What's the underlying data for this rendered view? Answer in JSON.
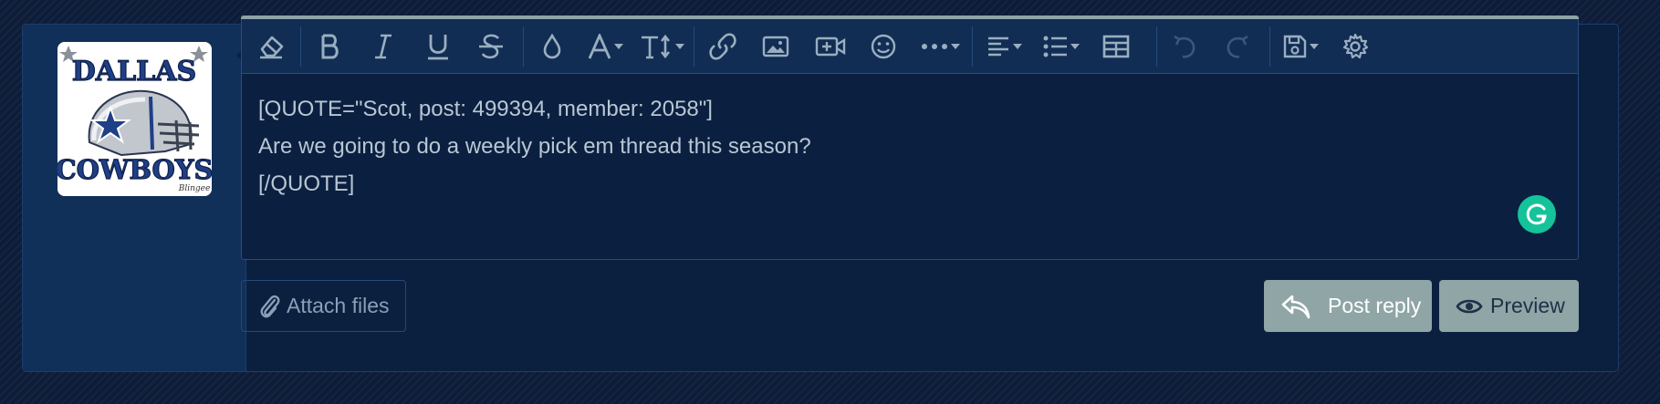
{
  "avatar": {
    "top_text": "DALLAS",
    "bottom_text": "COWBOYS",
    "signature": "Blingee"
  },
  "toolbar": [
    {
      "name": "eraser-icon"
    },
    {
      "name": "bold-icon"
    },
    {
      "name": "italic-icon"
    },
    {
      "name": "underline-icon"
    },
    {
      "name": "strikethrough-icon"
    },
    {
      "name": "text-color-icon"
    },
    {
      "name": "font-family-icon"
    },
    {
      "name": "font-size-icon"
    },
    {
      "name": "link-icon"
    },
    {
      "name": "image-icon"
    },
    {
      "name": "media-icon"
    },
    {
      "name": "emoji-icon"
    },
    {
      "name": "more-icon"
    },
    {
      "name": "align-icon"
    },
    {
      "name": "list-icon"
    },
    {
      "name": "table-icon"
    },
    {
      "name": "undo-icon",
      "disabled": true
    },
    {
      "name": "redo-icon",
      "disabled": true
    },
    {
      "name": "drafts-icon"
    },
    {
      "name": "settings-icon"
    }
  ],
  "editor": {
    "lines": [
      "[QUOTE=\"Scot, post: 499394, member: 2058\"]",
      "Are we going to do a weekly pick em thread this season?",
      "[/QUOTE]"
    ]
  },
  "actions": {
    "attach_label": "Attach files",
    "post_reply_label": "Post reply",
    "preview_label": "Preview"
  },
  "colors": {
    "page_bg": "#0d1c38",
    "panel_bg": "#0b1f3f",
    "toolbar_bg": "#112d54",
    "button_bg": "#8fa5a6",
    "grammarly": "#15c39a"
  }
}
